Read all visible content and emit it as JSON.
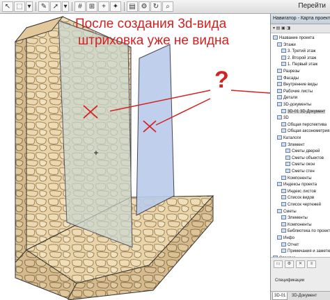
{
  "toolbar": {
    "goto_label": "Перейти",
    "icons": [
      "pointer-icon",
      "marquee-icon",
      "dropdown-icon",
      "eyedropper-icon",
      "arrow-icon",
      "grid-icon",
      "grid-snap-icon",
      "plus-snap-icon",
      "magic-wand-icon",
      "layers-icon",
      "settings-icon",
      "rotate-icon",
      "zoom-icon"
    ]
  },
  "annotation": {
    "line1": "После создания 3d-вида",
    "line2": "штриховка уже не видна",
    "question": "?",
    "color": "#d42121"
  },
  "navigator": {
    "title": "Навигатор - Карта проекта",
    "items": [
      {
        "label": "Название проекта",
        "indent": 0
      },
      {
        "label": "Этажи",
        "indent": 1
      },
      {
        "label": "3. Третий этаж",
        "indent": 2
      },
      {
        "label": "2. Второй этаж",
        "indent": 2
      },
      {
        "label": "1. Первый этаж",
        "indent": 2
      },
      {
        "label": "Разрезы",
        "indent": 1
      },
      {
        "label": "Фасады",
        "indent": 1
      },
      {
        "label": "Внутренние виды",
        "indent": 1
      },
      {
        "label": "Рабочие листы",
        "indent": 1
      },
      {
        "label": "Детали",
        "indent": 1
      },
      {
        "label": "3D-документы",
        "indent": 1
      },
      {
        "label": "3D-01 3D-Документ",
        "indent": 2
      },
      {
        "label": "3D",
        "indent": 1
      },
      {
        "label": "Общая перспектива",
        "indent": 2
      },
      {
        "label": "Общая аксонометрия",
        "indent": 2
      },
      {
        "label": "Каталоги",
        "indent": 1
      },
      {
        "label": "Элемент",
        "indent": 2
      },
      {
        "label": "Сметы дверей",
        "indent": 3
      },
      {
        "label": "Сметы объектов",
        "indent": 3
      },
      {
        "label": "Сметы окон",
        "indent": 3
      },
      {
        "label": "Сметы стен",
        "indent": 3
      },
      {
        "label": "Компоненты",
        "indent": 2
      },
      {
        "label": "Индексы проекта",
        "indent": 1
      },
      {
        "label": "Индекс листов",
        "indent": 2
      },
      {
        "label": "Список видов",
        "indent": 2
      },
      {
        "label": "Список чертежей",
        "indent": 2
      },
      {
        "label": "Сметы",
        "indent": 1
      },
      {
        "label": "Элементы",
        "indent": 2
      },
      {
        "label": "Компоненты",
        "indent": 2
      },
      {
        "label": "Библиотека по проекту",
        "indent": 2
      },
      {
        "label": "Инфо",
        "indent": 1
      },
      {
        "label": "Отчет",
        "indent": 2
      },
      {
        "label": "Примечания и заметки",
        "indent": 2
      },
      {
        "label": "Справка",
        "indent": 0
      }
    ],
    "bottom_label": "Спецификации",
    "tabs": [
      "3D-01",
      "3D-Документ"
    ]
  }
}
